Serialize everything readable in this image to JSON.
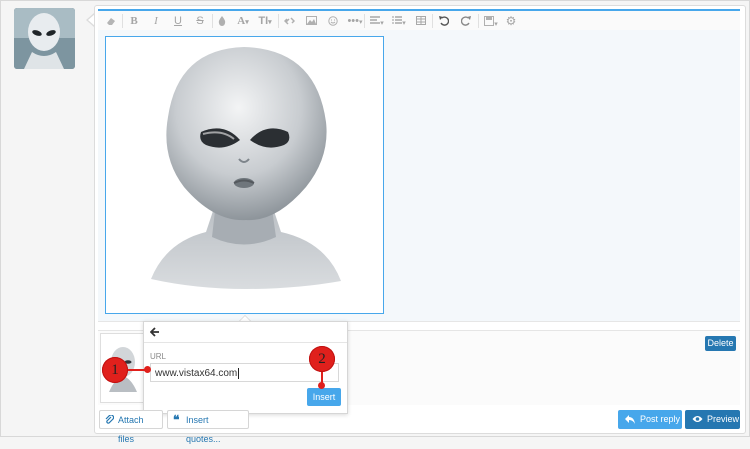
{
  "toolbar": {
    "icons": [
      "eraser-icon",
      "bold-icon",
      "italic-icon",
      "underline-icon",
      "strike-icon",
      "color-icon",
      "font-color-icon",
      "font-size-icon",
      "link-icon",
      "image-icon",
      "smilie-icon",
      "more-icon",
      "align-icon",
      "list-icon",
      "table-icon",
      "undo-icon",
      "redo-icon",
      "save-icon",
      "gear-icon"
    ],
    "glyphs": {
      "bold": "B",
      "italic": "I",
      "underline": "U",
      "strike": "S",
      "font_color": "A",
      "font_size": "TI"
    }
  },
  "popup": {
    "back_icon": "arrow-left-icon",
    "url_label": "URL",
    "url_value": "www.vistax64.com",
    "insert_label": "Insert"
  },
  "attachments": {
    "delete_label": "Delete"
  },
  "callouts": {
    "one": "1",
    "two": "2"
  },
  "footer": {
    "attach_files": "Attach files",
    "insert_quotes": "Insert quotes...",
    "post_reply": "Post reply",
    "preview": "Preview"
  },
  "colors": {
    "accent": "#47a7eb",
    "button_dark": "#2577b1",
    "callout": "#e0201c"
  }
}
